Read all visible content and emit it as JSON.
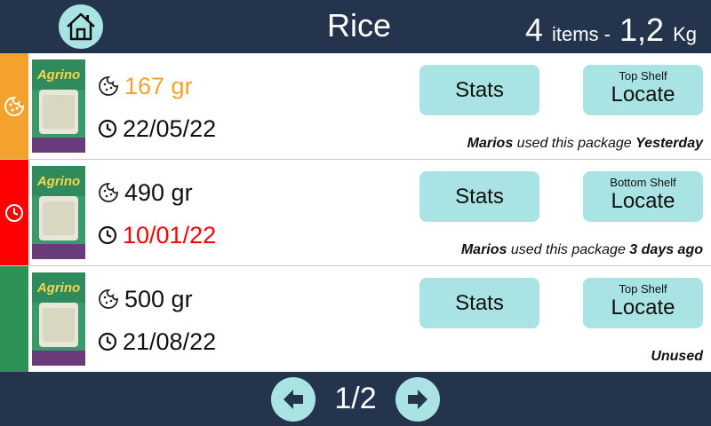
{
  "header": {
    "title": "Rice",
    "item_count": "4",
    "items_label": "items -",
    "total_weight": "1,2",
    "weight_unit": "Kg",
    "home_icon": "home-icon"
  },
  "package_image": {
    "brand": "Agrino",
    "variant": "Glace",
    "color": "#3a9a6a"
  },
  "colors": {
    "header_bg": "#24344d",
    "button_bg": "#a9e3e3",
    "orange": "#f2a22d",
    "red": "#ff0000",
    "green": "#2e9155"
  },
  "packages": [
    {
      "status_color": "#f2a22d",
      "status_icon": "cookie-icon",
      "weight": "167 gr",
      "weight_color": "#f2a22d",
      "date": "22/05/22",
      "date_color": "#111111",
      "stats_label": "Stats",
      "shelf": "Top Shelf",
      "locate_label": "Locate",
      "usage_user": "Marios",
      "usage_text": " used this package ",
      "usage_when": "Yesterday"
    },
    {
      "status_color": "#ff0000",
      "status_icon": "clock-icon",
      "weight": "490 gr",
      "weight_color": "#111111",
      "date": "10/01/22",
      "date_color": "#ff0000",
      "stats_label": "Stats",
      "shelf": "Bottom Shelf",
      "locate_label": "Locate",
      "usage_user": "Marios",
      "usage_text": " used this package ",
      "usage_when": "3 days ago"
    },
    {
      "status_color": "#2e9155",
      "status_icon": "",
      "weight": "500 gr",
      "weight_color": "#111111",
      "date": "21/08/22",
      "date_color": "#111111",
      "stats_label": "Stats",
      "shelf": "Top Shelf",
      "locate_label": "Locate",
      "usage_user": "",
      "usage_text": "",
      "usage_when": "Unused"
    }
  ],
  "pagination": {
    "page": "1/2",
    "prev_icon": "arrow-left-icon",
    "next_icon": "arrow-right-icon"
  }
}
